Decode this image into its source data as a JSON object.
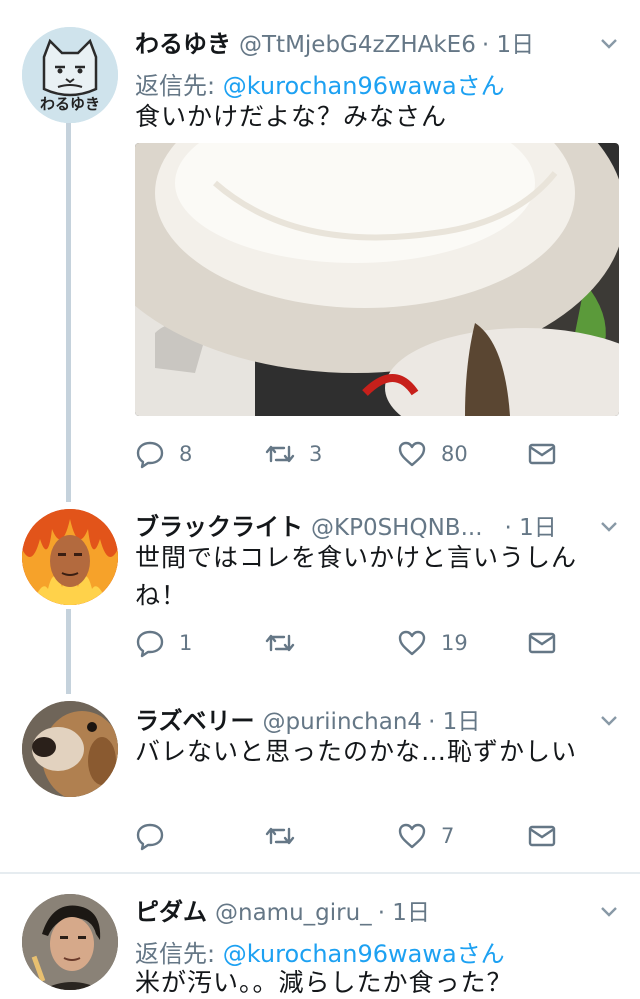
{
  "tweets": [
    {
      "name": "わるゆき",
      "handle": "@TtMjebG4zZHAkE6",
      "time": "· 1日",
      "reply_label": "返信先:",
      "reply_mention": "@kurochan96wawaさん",
      "text": "食いかけだよな？みなさん",
      "avatar_text": "わるゆき",
      "replies": "8",
      "retweets": "3",
      "likes": "80"
    },
    {
      "name": "ブラックライト",
      "handle": "@KP0SHQNB...",
      "time": "· 1日",
      "text": "世間ではコレを食いかけと言いうしんね！",
      "replies": "1",
      "retweets": "",
      "likes": "19"
    },
    {
      "name": "ラズベリー",
      "handle": "@puriinchan4",
      "time": "· 1日",
      "text": "バレないと思ったのかな…恥ずかしい",
      "replies": "",
      "retweets": "",
      "likes": "7"
    },
    {
      "name": "ピダム",
      "handle": "@namu_giru_",
      "time": "· 1日",
      "reply_label": "返信先:",
      "reply_mention": "@kurochan96wawaさん",
      "text": "米が汚い。。減らしたか食った？"
    }
  ],
  "colors": {
    "accent": "#1da1f2",
    "muted": "#657786",
    "thread_line": "#c5d2dc",
    "divider": "#e6ecf0"
  },
  "icons": [
    "reply-icon",
    "retweet-icon",
    "like-icon",
    "share-icon",
    "caret-down-icon"
  ]
}
